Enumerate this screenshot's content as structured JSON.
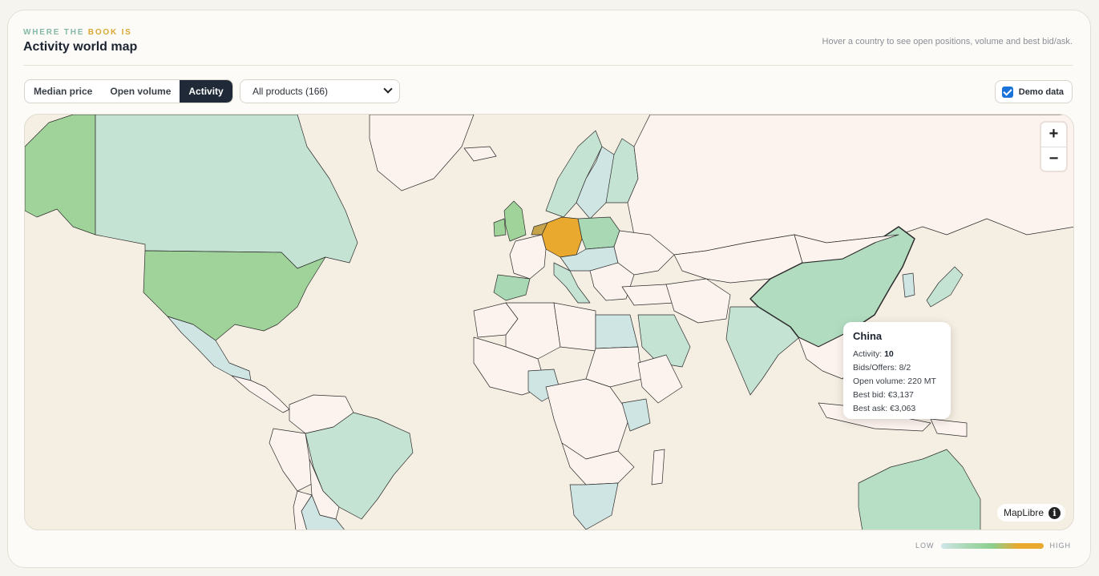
{
  "header": {
    "eyebrow_a": "WHERE THE",
    "eyebrow_b": "BOOK IS",
    "title": "Activity world map",
    "hint": "Hover a country to see open positions, volume and best bid/ask."
  },
  "toolbar": {
    "metrics": [
      {
        "label": "Median price",
        "active": false
      },
      {
        "label": "Open volume",
        "active": false
      },
      {
        "label": "Activity",
        "active": true
      }
    ],
    "product_select": "All products (166)",
    "demo_label": "Demo data",
    "demo_checked": true
  },
  "map": {
    "zoom_in": "+",
    "zoom_out": "−",
    "attribution": "MapLibre",
    "info": "i",
    "colors": {
      "ocean": "#f5eee2",
      "land_none": "#fdf3ee",
      "low": "#cde6e3",
      "mid": "#a8d9b4",
      "high_mid": "#95cf92",
      "high": "#e9a92e"
    }
  },
  "tooltip": {
    "country": "China",
    "activity_label": "Activity:",
    "activity_value": "10",
    "bids_offers": "Bids/Offers: 8/2",
    "open_volume": "Open volume: 220 MT",
    "best_bid": "Best bid: €3,137",
    "best_ask": "Best ask: €3,063"
  },
  "legend": {
    "low": "LOW",
    "high": "HIGH"
  }
}
